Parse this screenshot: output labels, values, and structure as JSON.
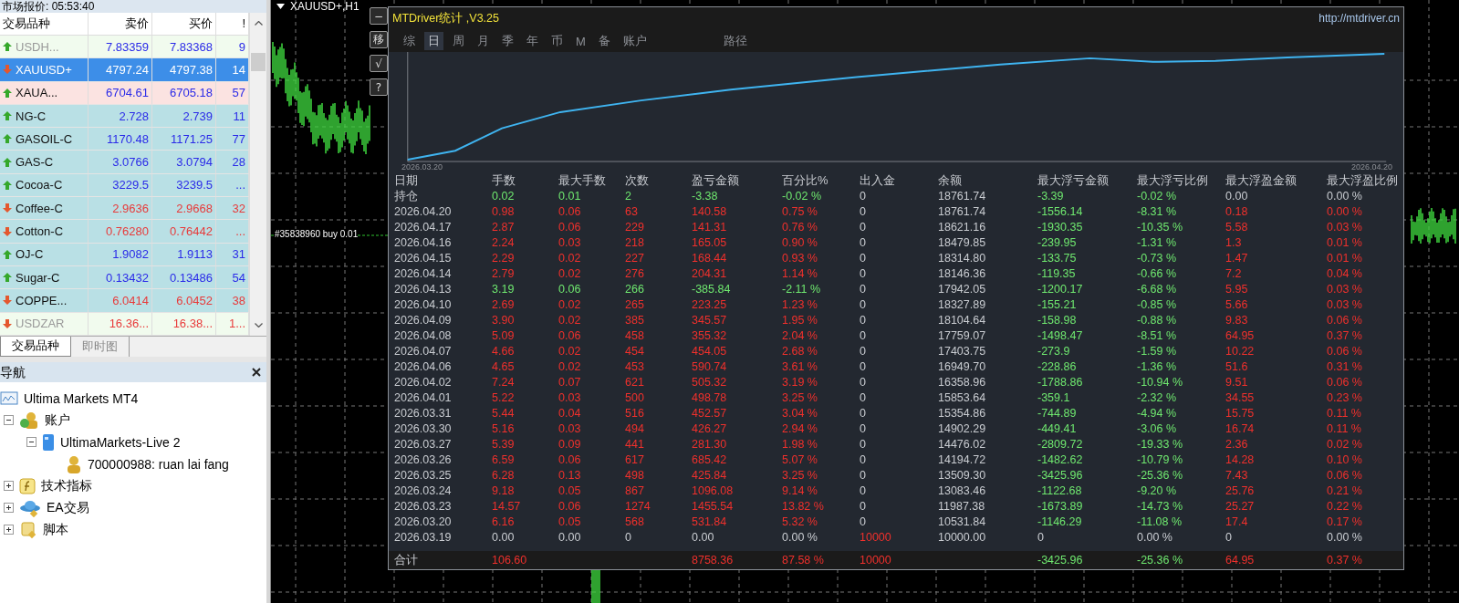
{
  "market_watch": {
    "title": "市场报价: 05:53:40",
    "columns": [
      "交易品种",
      "卖价",
      "买价",
      "!"
    ],
    "rows": [
      {
        "symbol": "USDH...",
        "bid": "7.83359",
        "ask": "7.83368",
        "spread": "9",
        "rising": true,
        "greyed": true,
        "selected": false,
        "color": "#f1fbee"
      },
      {
        "symbol": "XAUUSD+",
        "bid": "4797.24",
        "ask": "4797.38",
        "spread": "14",
        "rising": false,
        "greyed": false,
        "selected": true
      },
      {
        "symbol": "XAUA...",
        "bid": "6704.61",
        "ask": "6705.18",
        "spread": "57",
        "rising": true,
        "greyed": false,
        "selected": false,
        "color": "#fbe3e1"
      },
      {
        "symbol": "NG-C",
        "bid": "2.728",
        "ask": "2.739",
        "spread": "11",
        "rising": true,
        "greyed": false,
        "selected": false,
        "color": "#b9e0e5"
      },
      {
        "symbol": "GASOIL-C",
        "bid": "1170.48",
        "ask": "1171.25",
        "spread": "77",
        "rising": true,
        "greyed": false,
        "selected": false,
        "color": "#b9e0e5"
      },
      {
        "symbol": "GAS-C",
        "bid": "3.0766",
        "ask": "3.0794",
        "spread": "28",
        "rising": true,
        "greyed": false,
        "selected": false,
        "color": "#b9e0e5"
      },
      {
        "symbol": "Cocoa-C",
        "bid": "3229.5",
        "ask": "3239.5",
        "spread": "...",
        "rising": true,
        "greyed": false,
        "selected": false,
        "color": "#b9e0e5"
      },
      {
        "symbol": "Coffee-C",
        "bid": "2.9636",
        "ask": "2.9668",
        "spread": "32",
        "rising": false,
        "greyed": false,
        "selected": false,
        "color": "#b9e0e5"
      },
      {
        "symbol": "Cotton-C",
        "bid": "0.76280",
        "ask": "0.76442",
        "spread": "...",
        "rising": false,
        "greyed": false,
        "selected": false,
        "color": "#b9e0e5"
      },
      {
        "symbol": "OJ-C",
        "bid": "1.9082",
        "ask": "1.9113",
        "spread": "31",
        "rising": true,
        "greyed": false,
        "selected": false,
        "color": "#b9e0e5"
      },
      {
        "symbol": "Sugar-C",
        "bid": "0.13432",
        "ask": "0.13486",
        "spread": "54",
        "rising": true,
        "greyed": false,
        "selected": false,
        "color": "#b9e0e5"
      },
      {
        "symbol": "COPPE...",
        "bid": "6.0414",
        "ask": "6.0452",
        "spread": "38",
        "rising": false,
        "greyed": false,
        "selected": false,
        "color": "#b9e0e5"
      },
      {
        "symbol": "USDZAR",
        "bid": "16.36...",
        "ask": "16.38...",
        "spread": "1...",
        "rising": false,
        "greyed": true,
        "selected": false,
        "color": "#f1fbee"
      }
    ],
    "tabs": [
      {
        "label": "交易品种",
        "selected": true
      },
      {
        "label": "即时图",
        "selected": false
      }
    ]
  },
  "navigator": {
    "title": "导航",
    "tree": [
      {
        "label": "Ultima Markets MT4",
        "kind": "terminal",
        "children": [
          {
            "label": "账户",
            "kind": "accounts",
            "expanded": true,
            "children": [
              {
                "label": "UltimaMarkets-Live 2",
                "kind": "server",
                "expanded": true,
                "children": [
                  {
                    "label": "700000988: ruan lai fang",
                    "kind": "account"
                  }
                ]
              }
            ]
          },
          {
            "label": "技术指标",
            "kind": "indicators",
            "expanded": false
          },
          {
            "label": "EA交易",
            "kind": "experts",
            "expanded": false
          },
          {
            "label": "脚本",
            "kind": "scripts",
            "expanded": false
          }
        ]
      }
    ]
  },
  "chart": {
    "title": "XAUUSD+,H1",
    "buttons": [
      "−",
      "移",
      "√",
      "?"
    ],
    "order_label": "#35838960 buy 0.01"
  },
  "stats": {
    "title": "MTDriver统计 ,V3.25",
    "url": "http://mtdriver.cn",
    "tabs": [
      {
        "label": "综",
        "selected": false
      },
      {
        "label": "日",
        "selected": true
      },
      {
        "label": "周",
        "selected": false
      },
      {
        "label": "月",
        "selected": false
      },
      {
        "label": "季",
        "selected": false
      },
      {
        "label": "年",
        "selected": false
      },
      {
        "label": "币",
        "selected": false
      },
      {
        "label": "M",
        "selected": false
      },
      {
        "label": "备",
        "selected": false
      },
      {
        "label": "账户",
        "selected": false
      },
      {
        "label": "路径",
        "selected": false
      }
    ],
    "curve": {
      "start_label": "2026.03.20",
      "end_label": "2026.04.20"
    },
    "columns": [
      "日期",
      "手数",
      "最大手数",
      "次数",
      "盈亏金额",
      "百分比%",
      "出入金",
      "余额",
      "最大浮亏金额",
      "最大浮亏比例",
      "最大浮盈金额",
      "最大浮盈比例"
    ],
    "rows": [
      {
        "cells": [
          {
            "text": "持仓"
          },
          {
            "text": "0.02",
            "color": "#6fe86f"
          },
          {
            "text": "0.01",
            "color": "#6fe86f"
          },
          {
            "text": "2",
            "color": "#6fe86f"
          },
          {
            "text": "-3.38",
            "color": "#6fe86f"
          },
          {
            "text": "-0.02 %",
            "color": "#6fe86f"
          },
          {
            "text": "0",
            "color": "#c9ccd1"
          },
          {
            "text": "18761.74"
          },
          {
            "text": "-3.39",
            "color": "#6fe86f"
          },
          {
            "text": "-0.02 %",
            "color": "#6fe86f"
          },
          {
            "text": "0.00",
            "color": "#c9ccd1"
          },
          {
            "text": "0.00 %",
            "color": "#c9ccd1"
          }
        ]
      },
      {
        "cells": [
          {
            "text": "2026.04.20"
          },
          {
            "text": "0.98",
            "color": "#f0302c"
          },
          {
            "text": "0.06",
            "color": "#f0302c"
          },
          {
            "text": "63",
            "color": "#f0302c"
          },
          {
            "text": "140.58",
            "color": "#f0302c"
          },
          {
            "text": "0.75 %",
            "color": "#f0302c"
          },
          {
            "text": "0",
            "color": "#c9ccd1"
          },
          {
            "text": "18761.74"
          },
          {
            "text": "-1556.14",
            "color": "#6fe86f"
          },
          {
            "text": "-8.31 %",
            "color": "#6fe86f"
          },
          {
            "text": "0.18",
            "color": "#f0302c"
          },
          {
            "text": "0.00 %",
            "color": "#f0302c"
          }
        ]
      },
      {
        "cells": [
          {
            "text": "2026.04.17"
          },
          {
            "text": "2.87",
            "color": "#f0302c"
          },
          {
            "text": "0.06",
            "color": "#f0302c"
          },
          {
            "text": "229",
            "color": "#f0302c"
          },
          {
            "text": "141.31",
            "color": "#f0302c"
          },
          {
            "text": "0.76 %",
            "color": "#f0302c"
          },
          {
            "text": "0",
            "color": "#c9ccd1"
          },
          {
            "text": "18621.16"
          },
          {
            "text": "-1930.35",
            "color": "#6fe86f"
          },
          {
            "text": "-10.35 %",
            "color": "#6fe86f"
          },
          {
            "text": "5.58",
            "color": "#f0302c"
          },
          {
            "text": "0.03 %",
            "color": "#f0302c"
          }
        ]
      },
      {
        "cells": [
          {
            "text": "2026.04.16"
          },
          {
            "text": "2.24",
            "color": "#f0302c"
          },
          {
            "text": "0.03",
            "color": "#f0302c"
          },
          {
            "text": "218",
            "color": "#f0302c"
          },
          {
            "text": "165.05",
            "color": "#f0302c"
          },
          {
            "text": "0.90 %",
            "color": "#f0302c"
          },
          {
            "text": "0",
            "color": "#c9ccd1"
          },
          {
            "text": "18479.85"
          },
          {
            "text": "-239.95",
            "color": "#6fe86f"
          },
          {
            "text": "-1.31 %",
            "color": "#6fe86f"
          },
          {
            "text": "1.3",
            "color": "#f0302c"
          },
          {
            "text": "0.01 %",
            "color": "#f0302c"
          }
        ]
      },
      {
        "cells": [
          {
            "text": "2026.04.15"
          },
          {
            "text": "2.29",
            "color": "#f0302c"
          },
          {
            "text": "0.02",
            "color": "#f0302c"
          },
          {
            "text": "227",
            "color": "#f0302c"
          },
          {
            "text": "168.44",
            "color": "#f0302c"
          },
          {
            "text": "0.93 %",
            "color": "#f0302c"
          },
          {
            "text": "0",
            "color": "#c9ccd1"
          },
          {
            "text": "18314.80"
          },
          {
            "text": "-133.75",
            "color": "#6fe86f"
          },
          {
            "text": "-0.73 %",
            "color": "#6fe86f"
          },
          {
            "text": "1.47",
            "color": "#f0302c"
          },
          {
            "text": "0.01 %",
            "color": "#f0302c"
          }
        ]
      },
      {
        "cells": [
          {
            "text": "2026.04.14"
          },
          {
            "text": "2.79",
            "color": "#f0302c"
          },
          {
            "text": "0.02",
            "color": "#f0302c"
          },
          {
            "text": "276",
            "color": "#f0302c"
          },
          {
            "text": "204.31",
            "color": "#f0302c"
          },
          {
            "text": "1.14 %",
            "color": "#f0302c"
          },
          {
            "text": "0",
            "color": "#c9ccd1"
          },
          {
            "text": "18146.36"
          },
          {
            "text": "-119.35",
            "color": "#6fe86f"
          },
          {
            "text": "-0.66 %",
            "color": "#6fe86f"
          },
          {
            "text": "7.2",
            "color": "#f0302c"
          },
          {
            "text": "0.04 %",
            "color": "#f0302c"
          }
        ]
      },
      {
        "cells": [
          {
            "text": "2026.04.13"
          },
          {
            "text": "3.19",
            "color": "#6fe86f"
          },
          {
            "text": "0.06",
            "color": "#6fe86f"
          },
          {
            "text": "266",
            "color": "#6fe86f"
          },
          {
            "text": "-385.84",
            "color": "#6fe86f"
          },
          {
            "text": "-2.11 %",
            "color": "#6fe86f"
          },
          {
            "text": "0",
            "color": "#c9ccd1"
          },
          {
            "text": "17942.05"
          },
          {
            "text": "-1200.17",
            "color": "#6fe86f"
          },
          {
            "text": "-6.68 %",
            "color": "#6fe86f"
          },
          {
            "text": "5.95",
            "color": "#f0302c"
          },
          {
            "text": "0.03 %",
            "color": "#f0302c"
          }
        ]
      },
      {
        "cells": [
          {
            "text": "2026.04.10"
          },
          {
            "text": "2.69",
            "color": "#f0302c"
          },
          {
            "text": "0.02",
            "color": "#f0302c"
          },
          {
            "text": "265",
            "color": "#f0302c"
          },
          {
            "text": "223.25",
            "color": "#f0302c"
          },
          {
            "text": "1.23 %",
            "color": "#f0302c"
          },
          {
            "text": "0",
            "color": "#c9ccd1"
          },
          {
            "text": "18327.89"
          },
          {
            "text": "-155.21",
            "color": "#6fe86f"
          },
          {
            "text": "-0.85 %",
            "color": "#6fe86f"
          },
          {
            "text": "5.66",
            "color": "#f0302c"
          },
          {
            "text": "0.03 %",
            "color": "#f0302c"
          }
        ]
      },
      {
        "cells": [
          {
            "text": "2026.04.09"
          },
          {
            "text": "3.90",
            "color": "#f0302c"
          },
          {
            "text": "0.02",
            "color": "#f0302c"
          },
          {
            "text": "385",
            "color": "#f0302c"
          },
          {
            "text": "345.57",
            "color": "#f0302c"
          },
          {
            "text": "1.95 %",
            "color": "#f0302c"
          },
          {
            "text": "0",
            "color": "#c9ccd1"
          },
          {
            "text": "18104.64"
          },
          {
            "text": "-158.98",
            "color": "#6fe86f"
          },
          {
            "text": "-0.88 %",
            "color": "#6fe86f"
          },
          {
            "text": "9.83",
            "color": "#f0302c"
          },
          {
            "text": "0.06 %",
            "color": "#f0302c"
          }
        ]
      },
      {
        "cells": [
          {
            "text": "2026.04.08"
          },
          {
            "text": "5.09",
            "color": "#f0302c"
          },
          {
            "text": "0.06",
            "color": "#f0302c"
          },
          {
            "text": "458",
            "color": "#f0302c"
          },
          {
            "text": "355.32",
            "color": "#f0302c"
          },
          {
            "text": "2.04 %",
            "color": "#f0302c"
          },
          {
            "text": "0",
            "color": "#c9ccd1"
          },
          {
            "text": "17759.07"
          },
          {
            "text": "-1498.47",
            "color": "#6fe86f"
          },
          {
            "text": "-8.51 %",
            "color": "#6fe86f"
          },
          {
            "text": "64.95",
            "color": "#f0302c"
          },
          {
            "text": "0.37 %",
            "color": "#f0302c"
          }
        ]
      },
      {
        "cells": [
          {
            "text": "2026.04.07"
          },
          {
            "text": "4.66",
            "color": "#f0302c"
          },
          {
            "text": "0.02",
            "color": "#f0302c"
          },
          {
            "text": "454",
            "color": "#f0302c"
          },
          {
            "text": "454.05",
            "color": "#f0302c"
          },
          {
            "text": "2.68 %",
            "color": "#f0302c"
          },
          {
            "text": "0",
            "color": "#c9ccd1"
          },
          {
            "text": "17403.75"
          },
          {
            "text": "-273.9",
            "color": "#6fe86f"
          },
          {
            "text": "-1.59 %",
            "color": "#6fe86f"
          },
          {
            "text": "10.22",
            "color": "#f0302c"
          },
          {
            "text": "0.06 %",
            "color": "#f0302c"
          }
        ]
      },
      {
        "cells": [
          {
            "text": "2026.04.06"
          },
          {
            "text": "4.65",
            "color": "#f0302c"
          },
          {
            "text": "0.02",
            "color": "#f0302c"
          },
          {
            "text": "453",
            "color": "#f0302c"
          },
          {
            "text": "590.74",
            "color": "#f0302c"
          },
          {
            "text": "3.61 %",
            "color": "#f0302c"
          },
          {
            "text": "0",
            "color": "#c9ccd1"
          },
          {
            "text": "16949.70"
          },
          {
            "text": "-228.86",
            "color": "#6fe86f"
          },
          {
            "text": "-1.36 %",
            "color": "#6fe86f"
          },
          {
            "text": "51.6",
            "color": "#f0302c"
          },
          {
            "text": "0.31 %",
            "color": "#f0302c"
          }
        ]
      },
      {
        "cells": [
          {
            "text": "2026.04.02"
          },
          {
            "text": "7.24",
            "color": "#f0302c"
          },
          {
            "text": "0.07",
            "color": "#f0302c"
          },
          {
            "text": "621",
            "color": "#f0302c"
          },
          {
            "text": "505.32",
            "color": "#f0302c"
          },
          {
            "text": "3.19 %",
            "color": "#f0302c"
          },
          {
            "text": "0",
            "color": "#c9ccd1"
          },
          {
            "text": "16358.96"
          },
          {
            "text": "-1788.86",
            "color": "#6fe86f"
          },
          {
            "text": "-10.94 %",
            "color": "#6fe86f"
          },
          {
            "text": "9.51",
            "color": "#f0302c"
          },
          {
            "text": "0.06 %",
            "color": "#f0302c"
          }
        ]
      },
      {
        "cells": [
          {
            "text": "2026.04.01"
          },
          {
            "text": "5.22",
            "color": "#f0302c"
          },
          {
            "text": "0.03",
            "color": "#f0302c"
          },
          {
            "text": "500",
            "color": "#f0302c"
          },
          {
            "text": "498.78",
            "color": "#f0302c"
          },
          {
            "text": "3.25 %",
            "color": "#f0302c"
          },
          {
            "text": "0",
            "color": "#c9ccd1"
          },
          {
            "text": "15853.64"
          },
          {
            "text": "-359.1",
            "color": "#6fe86f"
          },
          {
            "text": "-2.32 %",
            "color": "#6fe86f"
          },
          {
            "text": "34.55",
            "color": "#f0302c"
          },
          {
            "text": "0.23 %",
            "color": "#f0302c"
          }
        ]
      },
      {
        "cells": [
          {
            "text": "2026.03.31"
          },
          {
            "text": "5.44",
            "color": "#f0302c"
          },
          {
            "text": "0.04",
            "color": "#f0302c"
          },
          {
            "text": "516",
            "color": "#f0302c"
          },
          {
            "text": "452.57",
            "color": "#f0302c"
          },
          {
            "text": "3.04 %",
            "color": "#f0302c"
          },
          {
            "text": "0",
            "color": "#c9ccd1"
          },
          {
            "text": "15354.86"
          },
          {
            "text": "-744.89",
            "color": "#6fe86f"
          },
          {
            "text": "-4.94 %",
            "color": "#6fe86f"
          },
          {
            "text": "15.75",
            "color": "#f0302c"
          },
          {
            "text": "0.11 %",
            "color": "#f0302c"
          }
        ]
      },
      {
        "cells": [
          {
            "text": "2026.03.30"
          },
          {
            "text": "5.16",
            "color": "#f0302c"
          },
          {
            "text": "0.03",
            "color": "#f0302c"
          },
          {
            "text": "494",
            "color": "#f0302c"
          },
          {
            "text": "426.27",
            "color": "#f0302c"
          },
          {
            "text": "2.94 %",
            "color": "#f0302c"
          },
          {
            "text": "0",
            "color": "#c9ccd1"
          },
          {
            "text": "14902.29"
          },
          {
            "text": "-449.41",
            "color": "#6fe86f"
          },
          {
            "text": "-3.06 %",
            "color": "#6fe86f"
          },
          {
            "text": "16.74",
            "color": "#f0302c"
          },
          {
            "text": "0.11 %",
            "color": "#f0302c"
          }
        ]
      },
      {
        "cells": [
          {
            "text": "2026.03.27"
          },
          {
            "text": "5.39",
            "color": "#f0302c"
          },
          {
            "text": "0.09",
            "color": "#f0302c"
          },
          {
            "text": "441",
            "color": "#f0302c"
          },
          {
            "text": "281.30",
            "color": "#f0302c"
          },
          {
            "text": "1.98 %",
            "color": "#f0302c"
          },
          {
            "text": "0",
            "color": "#c9ccd1"
          },
          {
            "text": "14476.02"
          },
          {
            "text": "-2809.72",
            "color": "#6fe86f"
          },
          {
            "text": "-19.33 %",
            "color": "#6fe86f"
          },
          {
            "text": "2.36",
            "color": "#f0302c"
          },
          {
            "text": "0.02 %",
            "color": "#f0302c"
          }
        ]
      },
      {
        "cells": [
          {
            "text": "2026.03.26"
          },
          {
            "text": "6.59",
            "color": "#f0302c"
          },
          {
            "text": "0.06",
            "color": "#f0302c"
          },
          {
            "text": "617",
            "color": "#f0302c"
          },
          {
            "text": "685.42",
            "color": "#f0302c"
          },
          {
            "text": "5.07 %",
            "color": "#f0302c"
          },
          {
            "text": "0",
            "color": "#c9ccd1"
          },
          {
            "text": "14194.72"
          },
          {
            "text": "-1482.62",
            "color": "#6fe86f"
          },
          {
            "text": "-10.79 %",
            "color": "#6fe86f"
          },
          {
            "text": "14.28",
            "color": "#f0302c"
          },
          {
            "text": "0.10 %",
            "color": "#f0302c"
          }
        ]
      },
      {
        "cells": [
          {
            "text": "2026.03.25"
          },
          {
            "text": "6.28",
            "color": "#f0302c"
          },
          {
            "text": "0.13",
            "color": "#f0302c"
          },
          {
            "text": "498",
            "color": "#f0302c"
          },
          {
            "text": "425.84",
            "color": "#f0302c"
          },
          {
            "text": "3.25 %",
            "color": "#f0302c"
          },
          {
            "text": "0",
            "color": "#c9ccd1"
          },
          {
            "text": "13509.30"
          },
          {
            "text": "-3425.96",
            "color": "#6fe86f"
          },
          {
            "text": "-25.36 %",
            "color": "#6fe86f"
          },
          {
            "text": "7.43",
            "color": "#f0302c"
          },
          {
            "text": "0.06 %",
            "color": "#f0302c"
          }
        ]
      },
      {
        "cells": [
          {
            "text": "2026.03.24"
          },
          {
            "text": "9.18",
            "color": "#f0302c"
          },
          {
            "text": "0.05",
            "color": "#f0302c"
          },
          {
            "text": "867",
            "color": "#f0302c"
          },
          {
            "text": "1096.08",
            "color": "#f0302c"
          },
          {
            "text": "9.14 %",
            "color": "#f0302c"
          },
          {
            "text": "0",
            "color": "#c9ccd1"
          },
          {
            "text": "13083.46"
          },
          {
            "text": "-1122.68",
            "color": "#6fe86f"
          },
          {
            "text": "-9.20 %",
            "color": "#6fe86f"
          },
          {
            "text": "25.76",
            "color": "#f0302c"
          },
          {
            "text": "0.21 %",
            "color": "#f0302c"
          }
        ]
      },
      {
        "cells": [
          {
            "text": "2026.03.23"
          },
          {
            "text": "14.57",
            "color": "#f0302c"
          },
          {
            "text": "0.06",
            "color": "#f0302c"
          },
          {
            "text": "1274",
            "color": "#f0302c"
          },
          {
            "text": "1455.54",
            "color": "#f0302c"
          },
          {
            "text": "13.82 %",
            "color": "#f0302c"
          },
          {
            "text": "0",
            "color": "#c9ccd1"
          },
          {
            "text": "11987.38"
          },
          {
            "text": "-1673.89",
            "color": "#6fe86f"
          },
          {
            "text": "-14.73 %",
            "color": "#6fe86f"
          },
          {
            "text": "25.27",
            "color": "#f0302c"
          },
          {
            "text": "0.22 %",
            "color": "#f0302c"
          }
        ]
      },
      {
        "cells": [
          {
            "text": "2026.03.20"
          },
          {
            "text": "6.16",
            "color": "#f0302c"
          },
          {
            "text": "0.05",
            "color": "#f0302c"
          },
          {
            "text": "568",
            "color": "#f0302c"
          },
          {
            "text": "531.84",
            "color": "#f0302c"
          },
          {
            "text": "5.32 %",
            "color": "#f0302c"
          },
          {
            "text": "0",
            "color": "#c9ccd1"
          },
          {
            "text": "10531.84"
          },
          {
            "text": "-1146.29",
            "color": "#6fe86f"
          },
          {
            "text": "-11.08 %",
            "color": "#6fe86f"
          },
          {
            "text": "17.4",
            "color": "#f0302c"
          },
          {
            "text": "0.17 %",
            "color": "#f0302c"
          }
        ]
      },
      {
        "cells": [
          {
            "text": "2026.03.19"
          },
          {
            "text": "0.00",
            "color": "#c9ccd1"
          },
          {
            "text": "0.00",
            "color": "#c9ccd1"
          },
          {
            "text": "0",
            "color": "#c9ccd1"
          },
          {
            "text": "0.00",
            "color": "#c9ccd1"
          },
          {
            "text": "0.00 %",
            "color": "#c9ccd1"
          },
          {
            "text": "10000",
            "color": "#f0302c"
          },
          {
            "text": "10000.00"
          },
          {
            "text": "0",
            "color": "#c9ccd1"
          },
          {
            "text": "0.00 %",
            "color": "#c9ccd1"
          },
          {
            "text": "0",
            "color": "#c9ccd1"
          },
          {
            "text": "0.00 %",
            "color": "#c9ccd1"
          }
        ]
      }
    ],
    "total": {
      "cells": [
        {
          "text": "合计"
        },
        {
          "text": "106.60",
          "color": "#f0302c"
        },
        null,
        null,
        {
          "text": "8758.36",
          "color": "#f0302c"
        },
        {
          "text": "87.58 %",
          "color": "#f0302c"
        },
        {
          "text": "10000",
          "color": "#f0302c"
        },
        null,
        {
          "text": "-3425.96",
          "color": "#6fe86f"
        },
        {
          "text": "-25.36 %",
          "color": "#6fe86f"
        },
        {
          "text": "64.95",
          "color": "#f0302c"
        },
        {
          "text": "0.37 %",
          "color": "#f0302c"
        }
      ]
    }
  }
}
